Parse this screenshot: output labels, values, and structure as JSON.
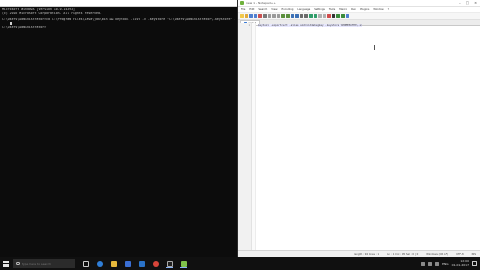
{
  "console": {
    "lines": [
      "Microsoft Windows [Version 10.0.14393]",
      "(c) 2016 Microsoft Corporation. All rights reserved.",
      "",
      "C:\\Users\\Administrator>cd C:\\Program Files\\Java\\jdk\\bin && keytool -list -v -keystore \"C:\\Users\\Administrator\\.keystore\" -alias android",
      "",
      "C:\\Users\\Administrator>"
    ]
  },
  "editor": {
    "title": "new 1 - Notepad++",
    "menu": [
      "File",
      "Edit",
      "Search",
      "View",
      "Encoding",
      "Language",
      "Settings",
      "Tools",
      "Macro",
      "Run",
      "Plugins",
      "Window",
      "?"
    ],
    "tab_label": "new 1",
    "line_numbers": [
      "1"
    ],
    "lines": [
      "keytool -exportcert -alias androiddebugkey -keystore %HOMEPATH%\\.android\\debug.keystore"
    ],
    "status": {
      "length": "length : 94   lines : 1",
      "position": "Ln : 1   Col : 95   Sel : 0 | 0",
      "eol": "Windows (CR LF)",
      "encoding": "UTF-8",
      "mode": "INS"
    }
  },
  "taskbar": {
    "search_placeholder": "Type here to search",
    "language": "ENG",
    "time": "12:00",
    "date": "01-01-2017"
  },
  "colors": {
    "console_bg": "#0c0c0c",
    "editor_line_highlight": "#e8e8ff",
    "taskbar_bg": "#101010"
  }
}
